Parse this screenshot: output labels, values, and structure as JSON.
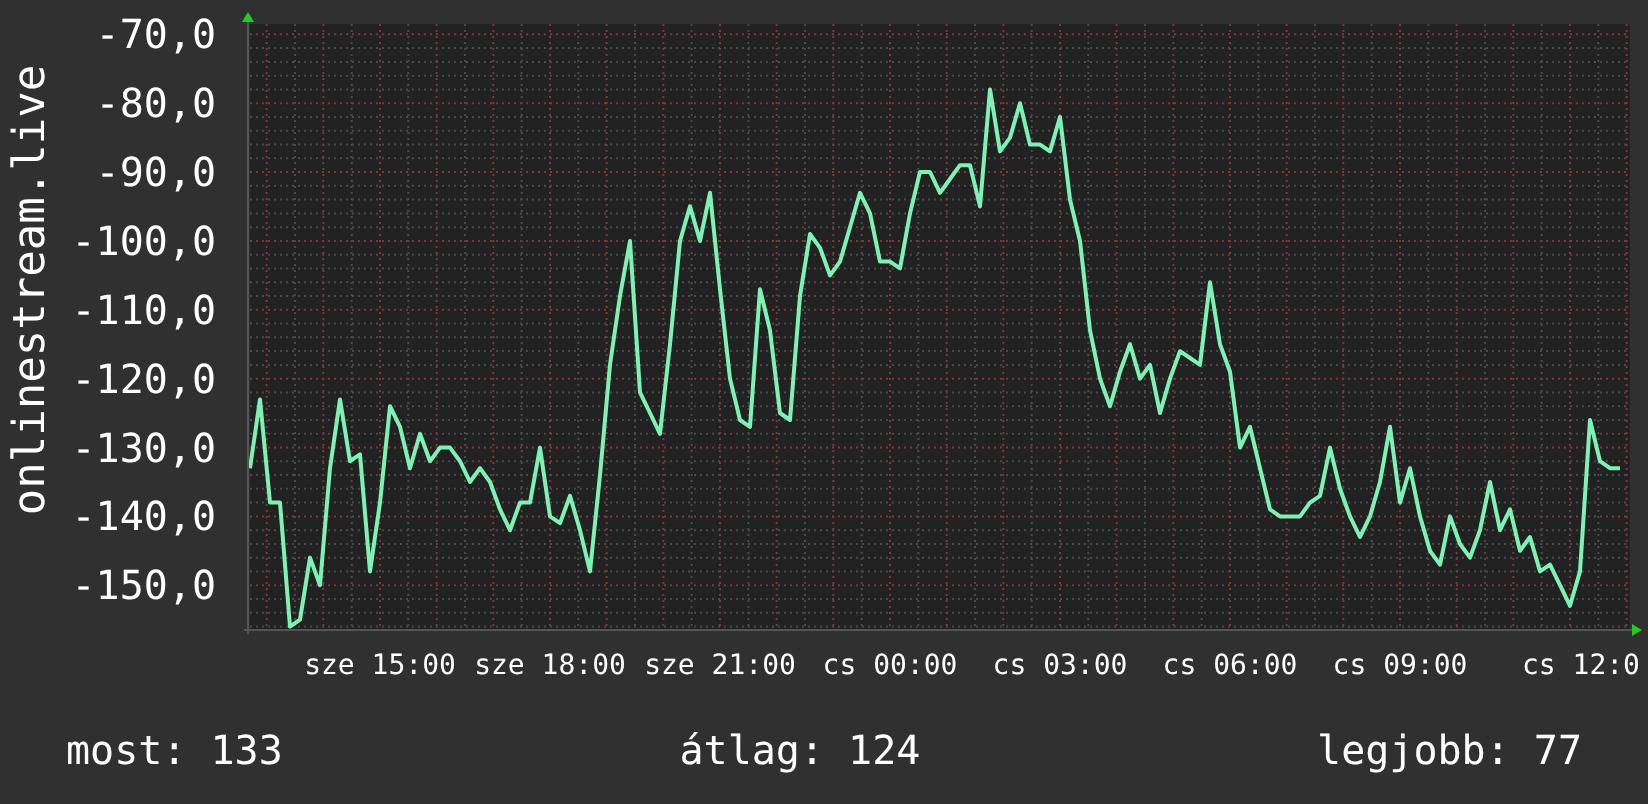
{
  "chart_data": {
    "type": "line",
    "ylabel": "onlinestream.live",
    "grid": true,
    "ylim": [
      -156.5,
      -68.5
    ],
    "categories": [
      null,
      null,
      null,
      null,
      null,
      null,
      null,
      null,
      null,
      null,
      null,
      null,
      null,
      "sze 15:00",
      null,
      null,
      null,
      null,
      null,
      null,
      null,
      null,
      null,
      null,
      null,
      null,
      null,
      null,
      null,
      null,
      "sze 18:00",
      null,
      null,
      null,
      null,
      null,
      null,
      null,
      null,
      null,
      null,
      null,
      null,
      null,
      null,
      null,
      null,
      "sze 21:00",
      null,
      null,
      null,
      null,
      null,
      null,
      null,
      null,
      null,
      null,
      null,
      null,
      null,
      null,
      null,
      null,
      "cs 00:00",
      null,
      null,
      null,
      null,
      null,
      null,
      null,
      null,
      null,
      null,
      null,
      null,
      null,
      null,
      null,
      null,
      "cs 03:00",
      null,
      null,
      null,
      null,
      null,
      null,
      null,
      null,
      null,
      null,
      null,
      null,
      null,
      null,
      null,
      null,
      "cs 06:00",
      null,
      null,
      null,
      null,
      null,
      null,
      null,
      null,
      null,
      null,
      null,
      null,
      null,
      null,
      null,
      null,
      "cs 09:00",
      null,
      null,
      null,
      null,
      null,
      null,
      null,
      null,
      null,
      null,
      null,
      null,
      null,
      null,
      null,
      null,
      "cs 12:0",
      null,
      null,
      null,
      null,
      null
    ],
    "yticks": [
      {
        "value": -70,
        "label": "-70,0"
      },
      {
        "value": -80,
        "label": "-80,0"
      },
      {
        "value": -90,
        "label": "-90,0"
      },
      {
        "value": -100,
        "label": "-100,0"
      },
      {
        "value": -110,
        "label": "-110,0"
      },
      {
        "value": -120,
        "label": "-120,0"
      },
      {
        "value": -130,
        "label": "-130,0"
      },
      {
        "value": -140,
        "label": "-140,0"
      },
      {
        "value": -150,
        "label": "-150,0"
      }
    ],
    "series": [
      {
        "color": "#7ef2b4",
        "values": [
          -133,
          -123,
          -138,
          -138,
          -156,
          -155,
          -146,
          -150,
          -133,
          -123,
          -132,
          -131,
          -148,
          -138,
          -124,
          -127,
          -133,
          -128,
          -132,
          -130,
          -130,
          -132,
          -135,
          -133,
          -135,
          -139,
          -142,
          -138,
          -138,
          -130,
          -140,
          -141,
          -137,
          -142,
          -148,
          -134,
          -118,
          -108,
          -100,
          -122,
          -125,
          -128,
          -115,
          -100,
          -95,
          -100,
          -93,
          -107,
          -120,
          -126,
          -127,
          -107,
          -113,
          -125,
          -126,
          -108,
          -99,
          -101,
          -105,
          -103,
          -98,
          -93,
          -96,
          -103,
          -103,
          -104,
          -96,
          -90,
          -90,
          -93,
          -91,
          -89,
          -89,
          -95,
          -78,
          -87,
          -85,
          -80,
          -86,
          -86,
          -87,
          -82,
          -94,
          -100,
          -113,
          -120,
          -124,
          -119,
          -115,
          -120,
          -118,
          -125,
          -120,
          -116,
          -117,
          -118,
          -106,
          -115,
          -119,
          -130,
          -127,
          -133,
          -139,
          -140,
          -140,
          -140,
          -138,
          -137,
          -130,
          -136,
          -140,
          -143,
          -140,
          -135,
          -127,
          -138,
          -133,
          -140,
          -145,
          -147,
          -140,
          -144,
          -146,
          -142,
          -135,
          -142,
          -139,
          -145,
          -143,
          -148,
          -147,
          -150,
          -153,
          -148,
          -126,
          -132,
          -133,
          -133
        ]
      }
    ]
  },
  "stats": [
    "most: 133",
    "átlag: 124",
    "legjobb: 77"
  ]
}
